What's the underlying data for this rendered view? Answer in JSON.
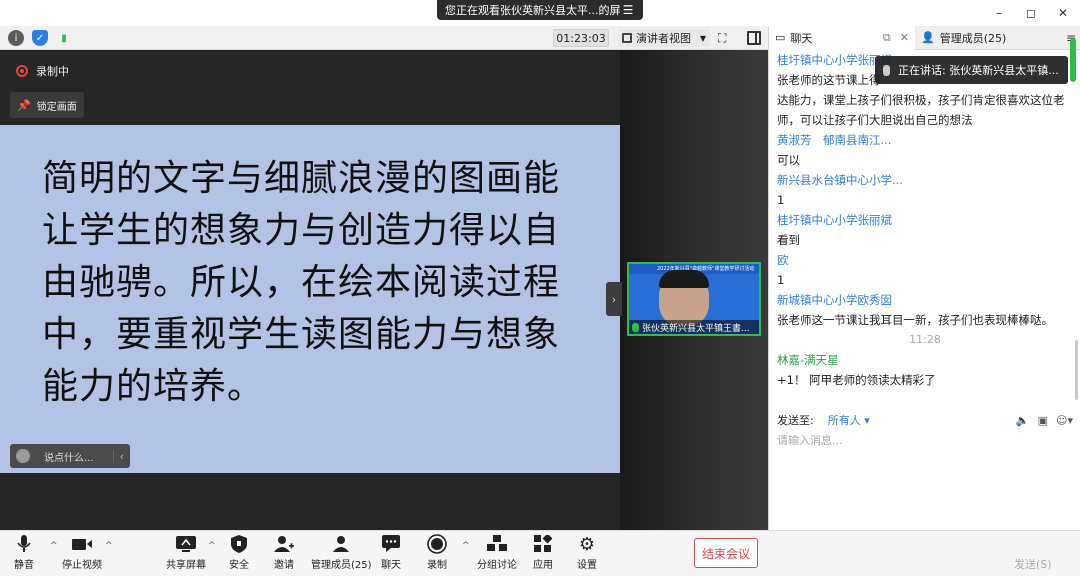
{
  "window": {
    "share_banner": "您正在观看张伙英新兴县太平...的屏幕",
    "controls": [
      "–",
      "◻",
      "✕"
    ]
  },
  "topbar": {
    "timer": "01:23:03",
    "view_mode": "演讲者视图",
    "colors": {
      "info": "#5b5b5b",
      "shield": "#2f7ee0",
      "signal": "#2fbd47"
    }
  },
  "main": {
    "recording_label": "录制中",
    "lock_label": "锁定画面",
    "slide_text": "简明的文字与细腻浪漫的图画能让学生的想象力与创造力得以自由驰骋。所以，在绘本阅读过程中，要重视学生读图能力与想象能力的培养。",
    "say_placeholder": "说点什么..."
  },
  "thumbnail": {
    "banner": "2022年新兴县\"卓越教师\"课堂教学研讨活动",
    "name": "张伙英新兴县太平镇王書..."
  },
  "chat": {
    "tab_chat": "聊天",
    "tab_members": "管理成员(25)",
    "speaking": "正在讲话: 张伙英新兴县太平镇...",
    "messages": [
      {
        "sender": "桂圩镇中心小学张丽斌",
        "text": "张老师的这节课上得"
      },
      {
        "sender": "",
        "text": "达能力，课堂上孩子们很积极，孩子们肯定很喜欢这位老师，可以让孩子们大胆说出自己的想法"
      },
      {
        "sender": "黄淑芳　郁南县南江...",
        "text": "可以"
      },
      {
        "sender": "新兴县水台镇中心小学...",
        "text": "1"
      },
      {
        "sender": "桂圩镇中心小学张丽斌",
        "text": "看到"
      },
      {
        "sender": "欧",
        "text": "1"
      },
      {
        "sender": "新城镇中心小学欧秀囡",
        "text": "张老师这一节课让我耳目一新，孩子们也表现棒棒哒。"
      }
    ],
    "time_divider": "11:28",
    "last_message": {
      "sender": "林嘉-满天星",
      "text": "+1！ 阿甲老师的领读太精彩了"
    },
    "send_to_label": "发送至:",
    "send_to_value": "所有人",
    "input_placeholder": "请输入消息...",
    "send_button": "发送(S)"
  },
  "toolbar": {
    "mute": "静音",
    "stop_video": "停止视频",
    "share": "共享屏幕",
    "security": "安全",
    "invite": "邀请",
    "members": "管理成员(25)",
    "chat": "聊天",
    "record": "录制",
    "breakout": "分组讨论",
    "apps": "应用",
    "settings": "设置",
    "end_meeting": "结束会议",
    "accent_red": "#e14a4a"
  }
}
